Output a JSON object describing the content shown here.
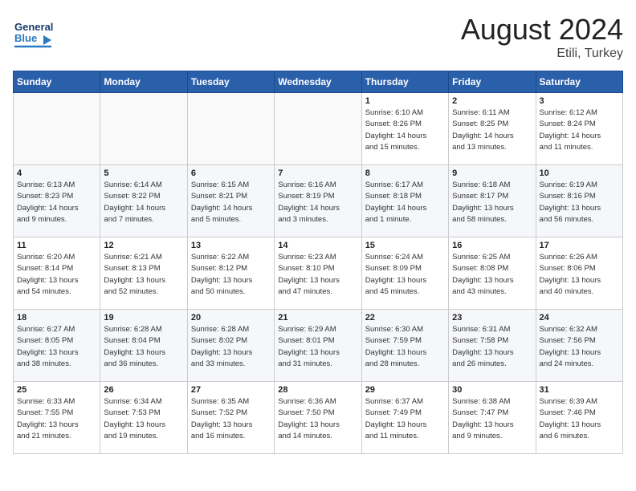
{
  "header": {
    "logo_line1": "General",
    "logo_line2": "Blue",
    "month": "August 2024",
    "location": "Etili, Turkey"
  },
  "weekdays": [
    "Sunday",
    "Monday",
    "Tuesday",
    "Wednesday",
    "Thursday",
    "Friday",
    "Saturday"
  ],
  "weeks": [
    [
      {
        "day": "",
        "info": ""
      },
      {
        "day": "",
        "info": ""
      },
      {
        "day": "",
        "info": ""
      },
      {
        "day": "",
        "info": ""
      },
      {
        "day": "1",
        "info": "Sunrise: 6:10 AM\nSunset: 8:26 PM\nDaylight: 14 hours\nand 15 minutes."
      },
      {
        "day": "2",
        "info": "Sunrise: 6:11 AM\nSunset: 8:25 PM\nDaylight: 14 hours\nand 13 minutes."
      },
      {
        "day": "3",
        "info": "Sunrise: 6:12 AM\nSunset: 8:24 PM\nDaylight: 14 hours\nand 11 minutes."
      }
    ],
    [
      {
        "day": "4",
        "info": "Sunrise: 6:13 AM\nSunset: 8:23 PM\nDaylight: 14 hours\nand 9 minutes."
      },
      {
        "day": "5",
        "info": "Sunrise: 6:14 AM\nSunset: 8:22 PM\nDaylight: 14 hours\nand 7 minutes."
      },
      {
        "day": "6",
        "info": "Sunrise: 6:15 AM\nSunset: 8:21 PM\nDaylight: 14 hours\nand 5 minutes."
      },
      {
        "day": "7",
        "info": "Sunrise: 6:16 AM\nSunset: 8:19 PM\nDaylight: 14 hours\nand 3 minutes."
      },
      {
        "day": "8",
        "info": "Sunrise: 6:17 AM\nSunset: 8:18 PM\nDaylight: 14 hours\nand 1 minute."
      },
      {
        "day": "9",
        "info": "Sunrise: 6:18 AM\nSunset: 8:17 PM\nDaylight: 13 hours\nand 58 minutes."
      },
      {
        "day": "10",
        "info": "Sunrise: 6:19 AM\nSunset: 8:16 PM\nDaylight: 13 hours\nand 56 minutes."
      }
    ],
    [
      {
        "day": "11",
        "info": "Sunrise: 6:20 AM\nSunset: 8:14 PM\nDaylight: 13 hours\nand 54 minutes."
      },
      {
        "day": "12",
        "info": "Sunrise: 6:21 AM\nSunset: 8:13 PM\nDaylight: 13 hours\nand 52 minutes."
      },
      {
        "day": "13",
        "info": "Sunrise: 6:22 AM\nSunset: 8:12 PM\nDaylight: 13 hours\nand 50 minutes."
      },
      {
        "day": "14",
        "info": "Sunrise: 6:23 AM\nSunset: 8:10 PM\nDaylight: 13 hours\nand 47 minutes."
      },
      {
        "day": "15",
        "info": "Sunrise: 6:24 AM\nSunset: 8:09 PM\nDaylight: 13 hours\nand 45 minutes."
      },
      {
        "day": "16",
        "info": "Sunrise: 6:25 AM\nSunset: 8:08 PM\nDaylight: 13 hours\nand 43 minutes."
      },
      {
        "day": "17",
        "info": "Sunrise: 6:26 AM\nSunset: 8:06 PM\nDaylight: 13 hours\nand 40 minutes."
      }
    ],
    [
      {
        "day": "18",
        "info": "Sunrise: 6:27 AM\nSunset: 8:05 PM\nDaylight: 13 hours\nand 38 minutes."
      },
      {
        "day": "19",
        "info": "Sunrise: 6:28 AM\nSunset: 8:04 PM\nDaylight: 13 hours\nand 36 minutes."
      },
      {
        "day": "20",
        "info": "Sunrise: 6:28 AM\nSunset: 8:02 PM\nDaylight: 13 hours\nand 33 minutes."
      },
      {
        "day": "21",
        "info": "Sunrise: 6:29 AM\nSunset: 8:01 PM\nDaylight: 13 hours\nand 31 minutes."
      },
      {
        "day": "22",
        "info": "Sunrise: 6:30 AM\nSunset: 7:59 PM\nDaylight: 13 hours\nand 28 minutes."
      },
      {
        "day": "23",
        "info": "Sunrise: 6:31 AM\nSunset: 7:58 PM\nDaylight: 13 hours\nand 26 minutes."
      },
      {
        "day": "24",
        "info": "Sunrise: 6:32 AM\nSunset: 7:56 PM\nDaylight: 13 hours\nand 24 minutes."
      }
    ],
    [
      {
        "day": "25",
        "info": "Sunrise: 6:33 AM\nSunset: 7:55 PM\nDaylight: 13 hours\nand 21 minutes."
      },
      {
        "day": "26",
        "info": "Sunrise: 6:34 AM\nSunset: 7:53 PM\nDaylight: 13 hours\nand 19 minutes."
      },
      {
        "day": "27",
        "info": "Sunrise: 6:35 AM\nSunset: 7:52 PM\nDaylight: 13 hours\nand 16 minutes."
      },
      {
        "day": "28",
        "info": "Sunrise: 6:36 AM\nSunset: 7:50 PM\nDaylight: 13 hours\nand 14 minutes."
      },
      {
        "day": "29",
        "info": "Sunrise: 6:37 AM\nSunset: 7:49 PM\nDaylight: 13 hours\nand 11 minutes."
      },
      {
        "day": "30",
        "info": "Sunrise: 6:38 AM\nSunset: 7:47 PM\nDaylight: 13 hours\nand 9 minutes."
      },
      {
        "day": "31",
        "info": "Sunrise: 6:39 AM\nSunset: 7:46 PM\nDaylight: 13 hours\nand 6 minutes."
      }
    ]
  ]
}
